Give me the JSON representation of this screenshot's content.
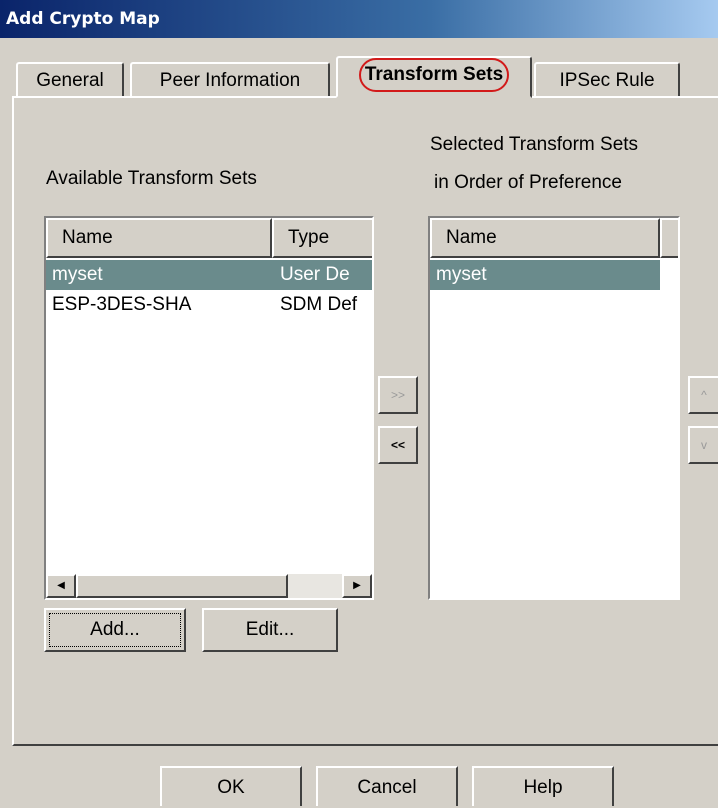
{
  "window": {
    "title": "Add Crypto Map"
  },
  "tabs": [
    {
      "label": "General"
    },
    {
      "label": "Peer Information"
    },
    {
      "label": "Transform Sets",
      "active": true
    },
    {
      "label": "IPSec Rule"
    }
  ],
  "available": {
    "label": "Available Transform Sets",
    "columns": [
      "Name",
      "Type"
    ],
    "rows": [
      {
        "name": "myset",
        "type": "User De",
        "selected": true
      },
      {
        "name": "ESP-3DES-SHA",
        "type": "SDM Def",
        "selected": false
      }
    ]
  },
  "selected": {
    "label_line1": "Selected Transform Sets",
    "label_line2": "in Order of Preference",
    "columns": [
      "Name"
    ],
    "rows": [
      {
        "name": "myset",
        "selected": true
      }
    ]
  },
  "transfer": {
    "add_all": ">>",
    "remove": "<<"
  },
  "order": {
    "up": "^",
    "down": "v"
  },
  "list_buttons": {
    "add": "Add...",
    "edit": "Edit..."
  },
  "footer": {
    "ok": "OK",
    "cancel": "Cancel",
    "help": "Help"
  },
  "colors": {
    "selection": "#6a8b8c",
    "highlight_circle": "#d21a1a",
    "titlebar": "#0a246a"
  }
}
